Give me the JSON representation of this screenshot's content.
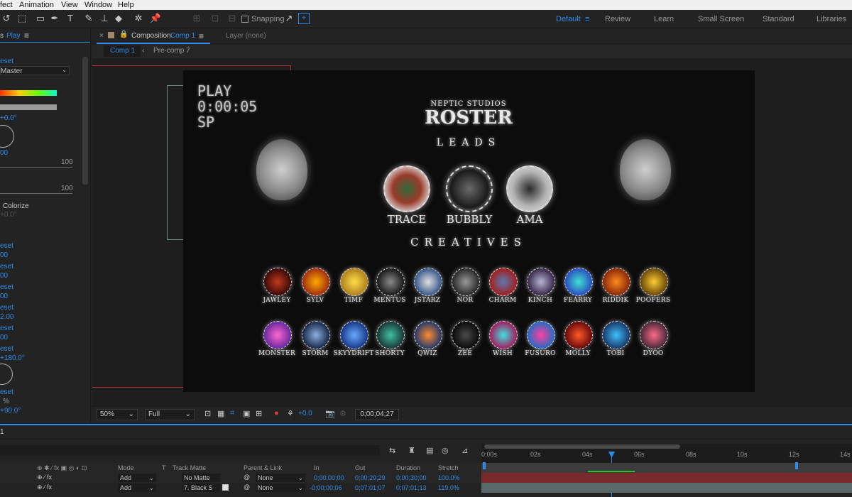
{
  "menu": [
    "fect",
    "Animation",
    "View",
    "Window",
    "Help"
  ],
  "toolbar": {
    "snapping": "Snapping",
    "workspaces": [
      "Default",
      "Review",
      "Learn",
      "Small Screen",
      "Standard",
      "Libraries"
    ],
    "active_workspace": "Default"
  },
  "effects_panel": {
    "title_prefix": "s",
    "title": "Play",
    "lines": [
      "eset",
      "Master",
      "+0.0°",
      "00",
      "100",
      "100",
      "Colorize",
      "+0.0°",
      "eset",
      "00",
      "eset",
      "00",
      "eset",
      "00",
      "eset",
      "2.00",
      "eset",
      "00",
      "eset",
      "+180.0°",
      "eset",
      "%",
      "+90.0°"
    ]
  },
  "comp_panel": {
    "tab_label": "Composition",
    "tab_comp": "Comp 1",
    "layer_label": "Layer (none)",
    "breadcrumbs": [
      "Comp 1",
      "Pre-comp 7"
    ]
  },
  "canvas": {
    "overlay": [
      "PLAY",
      "0:00:05",
      "SP"
    ],
    "studio": "NEPTIC STUDIOS",
    "title": "ROSTER",
    "leads_heading": "LEADS",
    "creatives_heading": "CREATIVES",
    "leads": [
      "TRACE",
      "BUBBLY",
      "AMA"
    ],
    "creatives_row1": [
      "JAWLEY",
      "SYLV",
      "TIMF",
      "MENTUS",
      "JSTARZ",
      "NOR",
      "CHARM",
      "KINCH",
      "FEARRY",
      "RIDDIK",
      "POOFERS"
    ],
    "creatives_row2": [
      "MONSTER",
      "STORM",
      "SKYYDRIFT",
      "SHORTY",
      "QWIZ",
      "ZEE",
      "WISH",
      "FUSURO",
      "MOLLY",
      "TOBI",
      "DYOO"
    ],
    "accent": "#2d8ceb"
  },
  "viewer_footer": {
    "zoom": "50%",
    "resolution": "Full",
    "exposure": "+0.0",
    "timecode": "0;00;04;27"
  },
  "timeline": {
    "tab_number": "1",
    "ruler": [
      "0:00s",
      "02s",
      "04s",
      "06s",
      "08s",
      "10s",
      "12s",
      "14s"
    ],
    "columns": [
      "Mode",
      "T",
      "Track Matte",
      "Parent & Link",
      "In",
      "Out",
      "Duration",
      "Stretch"
    ],
    "layers": [
      {
        "mode": "Add",
        "matte": "No Matte",
        "parent": "None",
        "in": "0;00;00;00",
        "out": "0;00;29;29",
        "duration": "0;00;30;00",
        "stretch": "100.0%"
      },
      {
        "mode": "Add",
        "matte": "7. Black S",
        "parent": "None",
        "in": "-0;00;00;06",
        "out": "0;07;01;07",
        "duration": "0;07;01;13",
        "stretch": "119.0%"
      }
    ]
  }
}
